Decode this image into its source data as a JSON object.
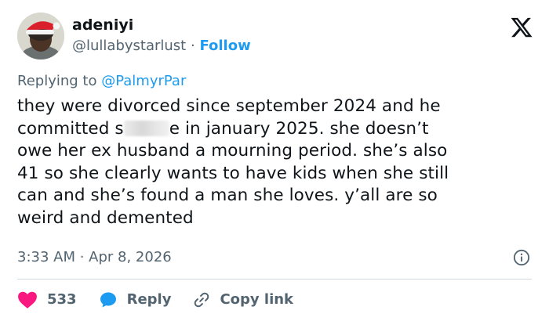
{
  "user": {
    "name": "adeniyi",
    "handle": "@lullabystarlust",
    "separator": "·",
    "follow_label": "Follow"
  },
  "replying": {
    "prefix": "Replying to ",
    "mention": "@PalmyrPar"
  },
  "tweet": {
    "line_1": "they were divorced since september 2024 and he",
    "line_2_pre": "committed s",
    "line_2_post": "e in january 2025. she doesn’t",
    "rest": "owe her ex husband a mourning period. she’s also\n41 so she clearly wants to have kids when she still\ncan and she’s found a man she loves. y’all are so\nweird and demented"
  },
  "meta": {
    "timestamp": "3:33 AM · Apr 8, 2026"
  },
  "actions": {
    "like_count": "533",
    "reply_label": "Reply",
    "copy_label": "Copy link"
  },
  "colors": {
    "accent": "#1d9bf0",
    "heart": "#f91880",
    "text": "#0f1419",
    "secondary": "#536471"
  },
  "icons": {
    "brand": "x-logo-icon",
    "info": "info-icon",
    "like": "heart-icon",
    "reply": "reply-bubble-icon",
    "copy": "link-icon"
  }
}
